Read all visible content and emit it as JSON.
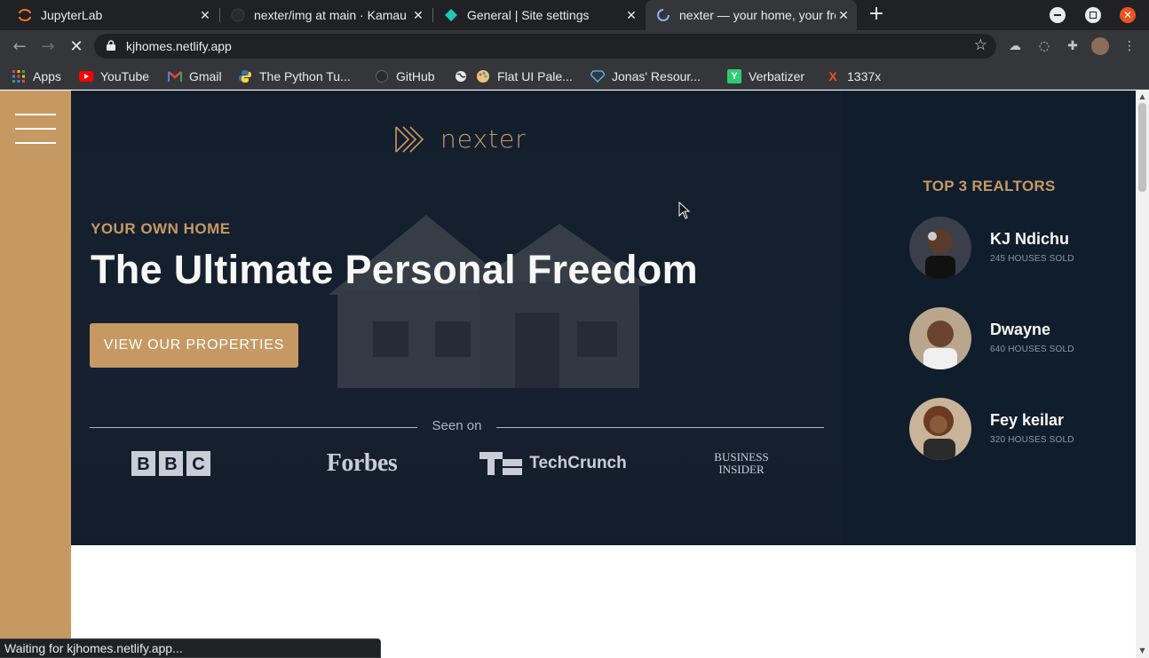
{
  "browser": {
    "tabs": [
      {
        "title": "JupyterLab",
        "icon": "jupyter-icon",
        "active": false
      },
      {
        "title": "nexter/img at main · Kamau",
        "icon": "github-icon",
        "active": false
      },
      {
        "title": "General | Site settings",
        "icon": "netlify-icon",
        "active": false
      },
      {
        "title": "nexter — your home, your freedom",
        "icon": "loading-spinner-icon",
        "active": true
      }
    ],
    "new_tab_label": "+",
    "url": "kjhomes.netlify.app",
    "bookmarks": [
      {
        "label": "Apps",
        "icon": "apps-grid-icon"
      },
      {
        "label": "YouTube",
        "icon": "youtube-icon"
      },
      {
        "label": "Gmail",
        "icon": "gmail-icon"
      },
      {
        "label": "The Python Tu...",
        "icon": "python-icon"
      },
      {
        "label": "GitHub",
        "icon": "github-icon"
      },
      {
        "label": "",
        "icon": "globe-icon"
      },
      {
        "label": "Flat UI Pale...",
        "icon": "palette-icon"
      },
      {
        "label": "Jonas' Resour...",
        "icon": "diamond-icon"
      },
      {
        "label": "Verbatizer",
        "icon": "verbatizer-icon"
      },
      {
        "label": "1337x",
        "icon": "x-icon"
      }
    ],
    "status_text": "Waiting for kjhomes.netlify.app..."
  },
  "page": {
    "logo_text": "nexter",
    "hero": {
      "subtitle": "YOUR OWN HOME",
      "title": "The Ultimate Personal Freedom",
      "cta_label": "VIEW OUR PROPERTIES",
      "seen_on": "Seen on",
      "press": [
        "BBC",
        "Forbes",
        "TechCrunch",
        "Business Insider"
      ],
      "press_business_line1": "BUSINESS",
      "press_business_line2": "INSIDER"
    },
    "realtors": {
      "title": "TOP 3 REALTORS",
      "list": [
        {
          "name": "KJ Ndichu",
          "sold": "245 HOUSES SOLD"
        },
        {
          "name": "Dwayne",
          "sold": "640 HOUSES SOLD"
        },
        {
          "name": "Fey keilar",
          "sold": "320 HOUSES SOLD"
        }
      ]
    }
  },
  "colors": {
    "primary": "#c69963",
    "dark": "#101d2c",
    "light": "#f9f7f6",
    "chrome_dark": "#202124",
    "chrome_mid": "#35363a"
  }
}
